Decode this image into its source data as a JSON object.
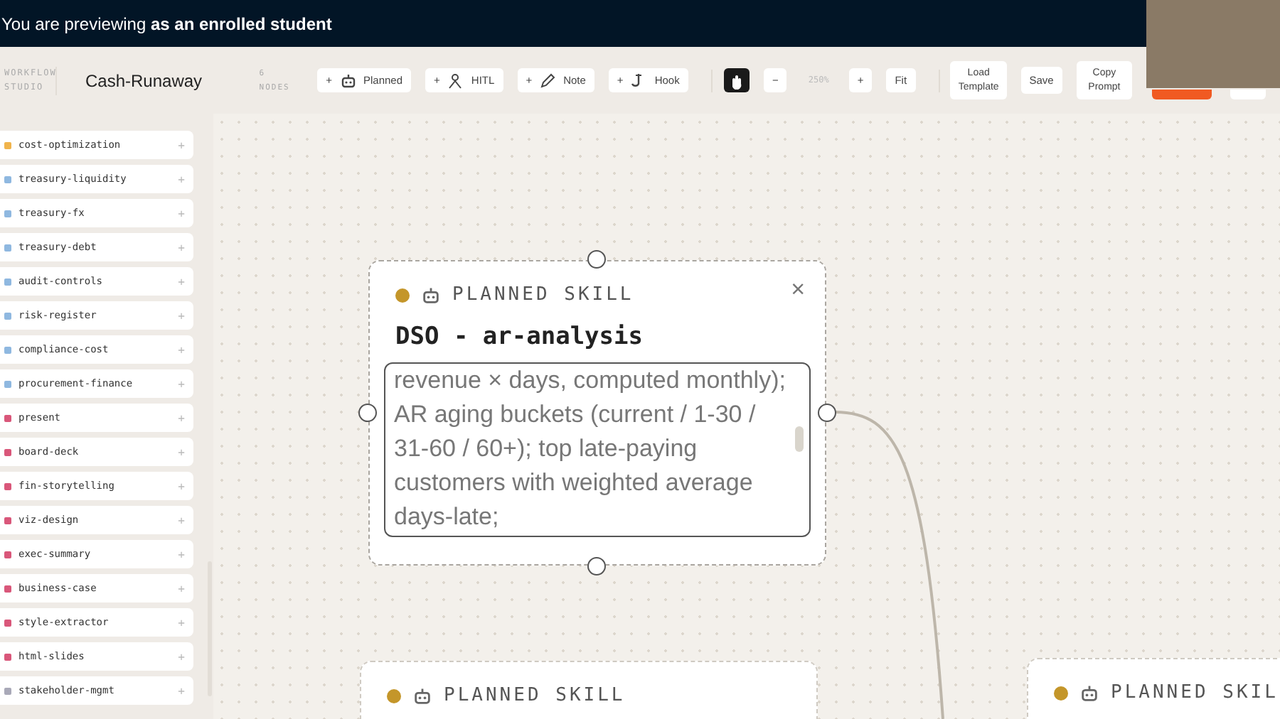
{
  "banner": {
    "text": "You are previewing **as an enrolled student**"
  },
  "toolbar": {
    "brand": "WORKFLOW STUDIO",
    "title": "Cash-Runaway",
    "node_count": "6 NODES",
    "add_buttons": [
      {
        "kind": "planned",
        "mark": "+",
        "label": "Planned"
      },
      {
        "kind": "hitl",
        "mark": "+",
        "label": "HITL"
      },
      {
        "kind": "note",
        "mark": "+",
        "label": "Note"
      },
      {
        "kind": "hook",
        "mark": "+",
        "label": "Hook"
      }
    ],
    "pan_tool": {
      "selected": true
    },
    "zoom": {
      "minus": "−",
      "value": "250%",
      "plus": "+",
      "fit": "Fit"
    },
    "actions": [
      {
        "kind": "text",
        "label": "Load Template"
      },
      {
        "kind": "text",
        "label": "Save"
      },
      {
        "kind": "text",
        "label": "Copy Prompt"
      },
      {
        "kind": "primary"
      },
      {
        "kind": "plain"
      }
    ]
  },
  "video": {
    "shown": true
  },
  "sidebar": {
    "items": [
      {
        "label": "cost-optimization",
        "color": "#f0b44c",
        "add": "+"
      },
      {
        "label": "treasury-liquidity",
        "color": "#8fb8e0",
        "add": "+"
      },
      {
        "label": "treasury-fx",
        "color": "#8fb8e0",
        "add": "+"
      },
      {
        "label": "treasury-debt",
        "color": "#8fb8e0",
        "add": "+"
      },
      {
        "label": "audit-controls",
        "color": "#8fb8e0",
        "add": "+"
      },
      {
        "label": "risk-register",
        "color": "#8fb8e0",
        "add": "+"
      },
      {
        "label": "compliance-cost",
        "color": "#8fb8e0",
        "add": "+"
      },
      {
        "label": "procurement-finance",
        "color": "#8fb8e0",
        "add": "+"
      },
      {
        "label": "present",
        "color": "#d9577a",
        "add": "+"
      },
      {
        "label": "board-deck",
        "color": "#d9577a",
        "add": "+"
      },
      {
        "label": "fin-storytelling",
        "color": "#d9577a",
        "add": "+"
      },
      {
        "label": "viz-design",
        "color": "#d9577a",
        "add": "+"
      },
      {
        "label": "exec-summary",
        "color": "#d9577a",
        "add": "+"
      },
      {
        "label": "business-case",
        "color": "#d9577a",
        "add": "+"
      },
      {
        "label": "style-extractor",
        "color": "#d9577a",
        "add": "+"
      },
      {
        "label": "html-slides",
        "color": "#d9577a",
        "add": "+"
      },
      {
        "label": "stakeholder-mgmt",
        "color": "#a9a9b8",
        "add": "+"
      }
    ]
  },
  "canvas": {
    "nodes": [
      {
        "type_label": "PLANNED SKILL",
        "color": "#c4962a",
        "selected": true,
        "close": "×",
        "title": "DSO - ar-analysis",
        "description": "revenue × days, computed monthly); AR aging buckets (current / 1-30 / 31-60 / 60+); top late-paying customers with weighted average days-late;"
      },
      {
        "type_label": "PLANNED SKILL",
        "color": "#c4962a",
        "selected": false
      },
      {
        "type_label": "PLANNED SKIL",
        "color": "#c4962a",
        "selected": false
      }
    ]
  }
}
